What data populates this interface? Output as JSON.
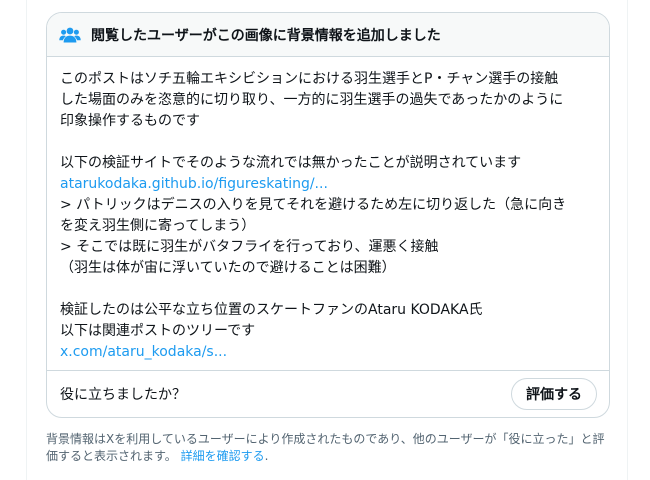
{
  "note": {
    "header_title": "閲覧したユーザーがこの画像に背景情報を追加しました",
    "header_icon": "people-icon",
    "body_lines": [
      "このポストはソチ五輪エキシビションにおける羽生選手とP・チャン選手の接触",
      "した場面のみを恣意的に切り取り、一方的に羽生選手の過失であったかのように",
      "印象操作するものです",
      "以下の検証サイトでそのような流れでは無かったことが説明されています",
      "> パトリックはデニスの入りを見てそれを避けるため左に切り返した（急に向き",
      "を変え羽生側に寄ってしまう）",
      "> そこでは既に羽生がバタフライを行っており、運悪く接触",
      "（羽生は体が宙に浮いていたので避けることは困難）",
      "検証したのは公平な立ち位置のスケートファンのAtaru KODAKA氏",
      "以下は関連ポストのツリーです"
    ],
    "link1": "atarukodaka.github.io/figureskating/...",
    "link2": "x.com/ataru_kodaka/s..."
  },
  "helpful": {
    "question": "役に立ちましたか？",
    "rate_button": "評価する"
  },
  "footer": {
    "text": "背景情報はXを利用しているユーザーにより作成されたものであり、他のユーザーが「役に立った」と評価すると表示されます。",
    "link": "詳細を確認する",
    "period": "."
  },
  "colors": {
    "link": "#1d9bf0",
    "border": "#cfd9de",
    "header_bg": "#f7f9f9",
    "text": "#0f1419",
    "secondary": "#536471"
  }
}
